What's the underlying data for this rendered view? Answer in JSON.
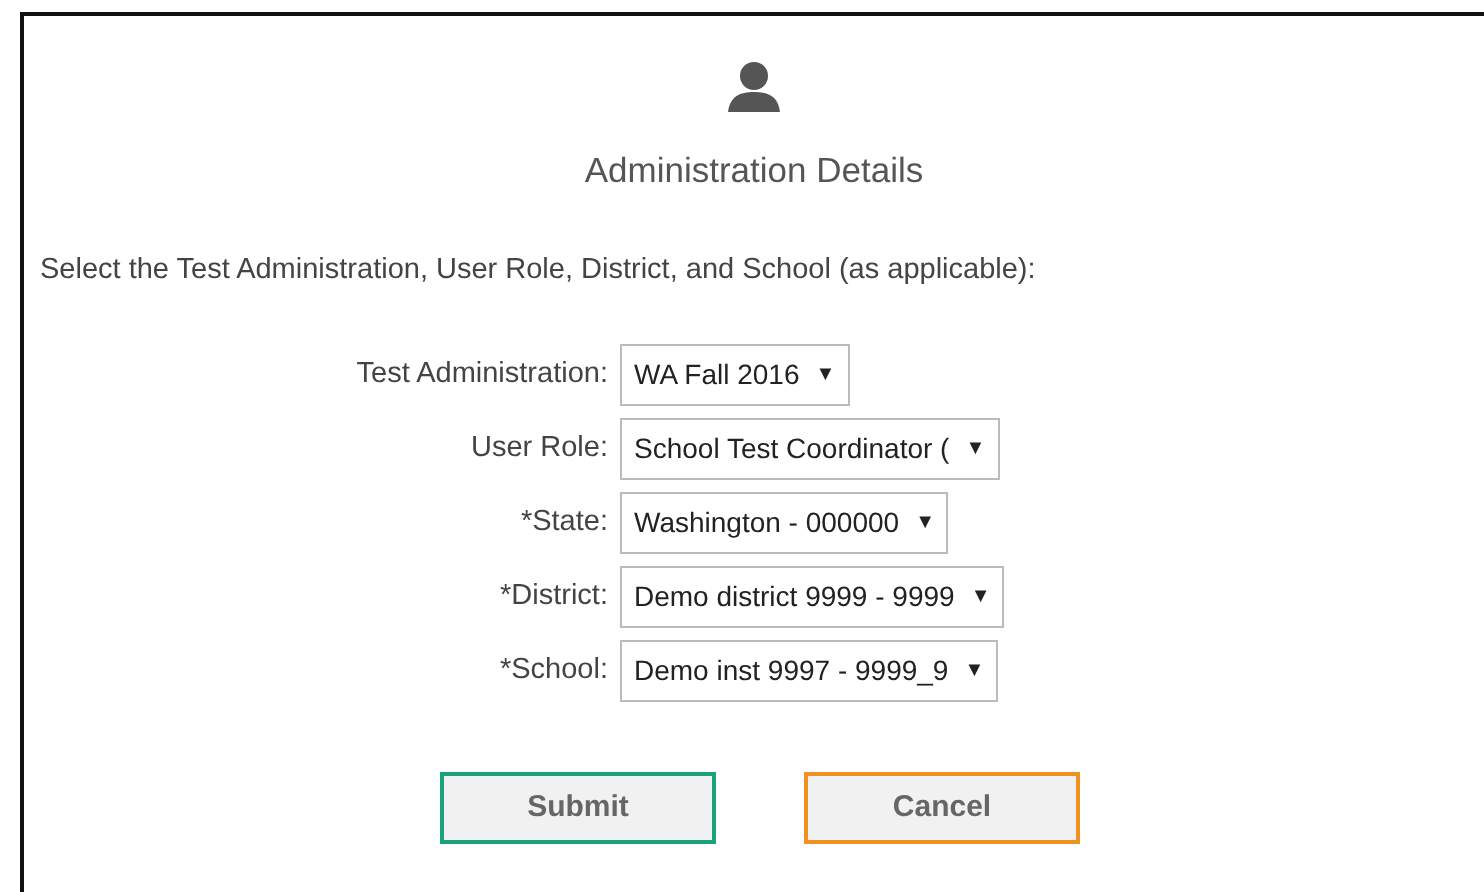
{
  "heading": "Administration Details",
  "instructions": "Select the Test Administration, User Role, District, and School (as applicable):",
  "fields": [
    {
      "label": "Test Administration:",
      "value": "WA Fall 2016",
      "arrow": "▼"
    },
    {
      "label": "User Role:",
      "value": "School Test Coordinator (",
      "arrow": "▼"
    },
    {
      "label": "*State:",
      "value": "Washington - 000000",
      "arrow": "▼"
    },
    {
      "label": "*District:",
      "value": "Demo district 9999 - 9999",
      "arrow": "▼"
    },
    {
      "label": "*School:",
      "value": "Demo inst 9997 - 9999_9",
      "arrow": "▼"
    }
  ],
  "buttons": [
    {
      "label": "Submit",
      "color": "#1aa37a"
    },
    {
      "label": "Cancel",
      "color": "#f0921e"
    }
  ]
}
